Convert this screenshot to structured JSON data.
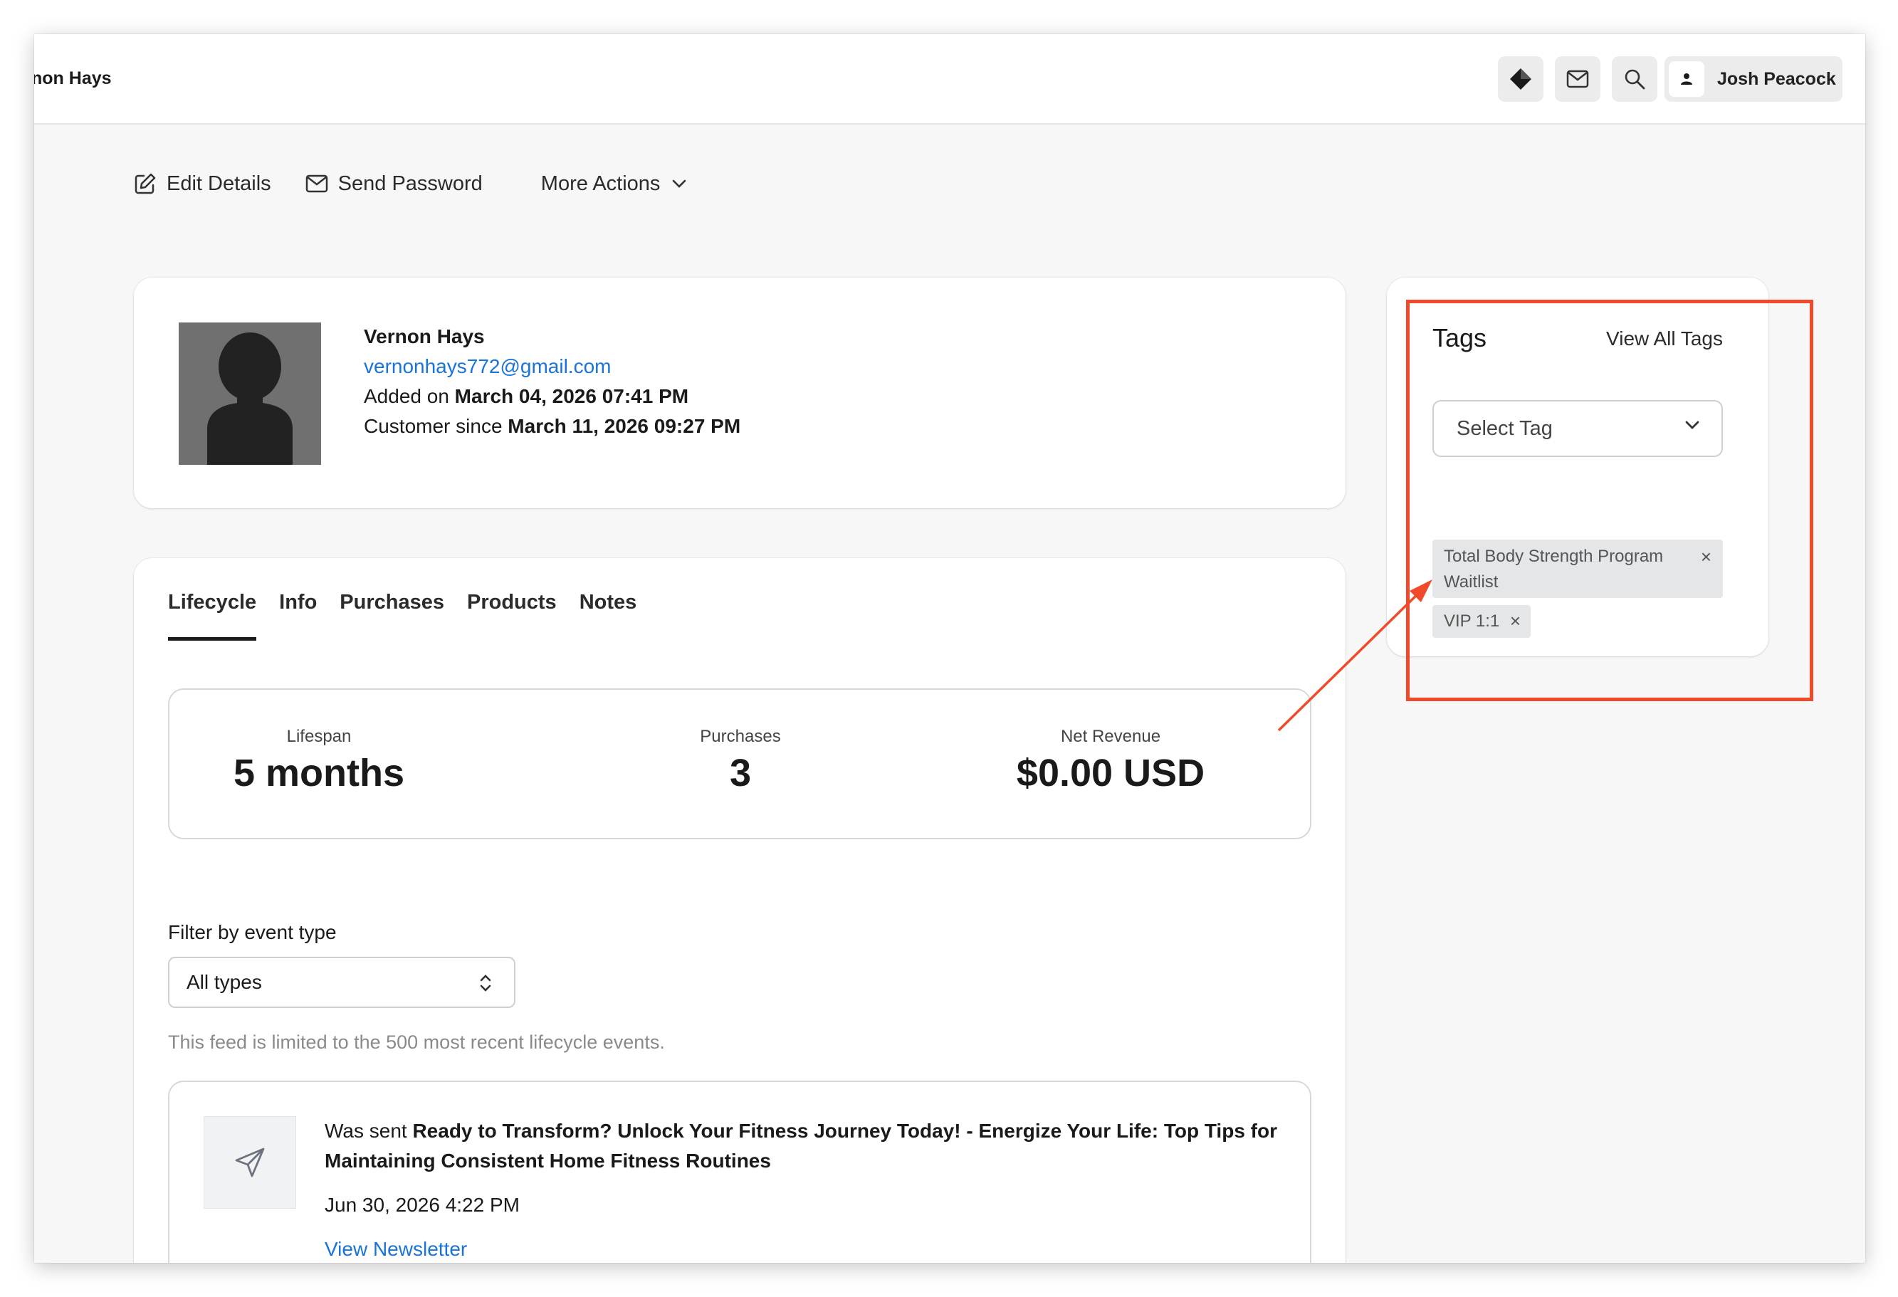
{
  "header": {
    "title_fragment": "non Hays",
    "icons": [
      "diamond-icon",
      "mail-icon",
      "search-icon",
      "user-icon"
    ],
    "user_name": "Josh Peacock"
  },
  "actions": {
    "edit": "Edit Details",
    "send_password": "Send Password",
    "more": "More Actions"
  },
  "profile": {
    "name": "Vernon Hays",
    "email": "vernonhays772@gmail.com",
    "added_prefix": "Added on",
    "added_date": "March 04, 2026 07:41 PM",
    "customer_prefix": "Customer since",
    "customer_date": "March 11, 2026 09:27 PM"
  },
  "tabs": [
    "Lifecycle",
    "Info",
    "Purchases",
    "Products",
    "Notes"
  ],
  "active_tab": "Lifecycle",
  "stats": [
    {
      "label": "Lifespan",
      "value": "5 months"
    },
    {
      "label": "Purchases",
      "value": "3"
    },
    {
      "label": "Net Revenue",
      "value": "$0.00 USD"
    }
  ],
  "filter": {
    "label": "Filter by event type",
    "selected": "All types",
    "note": "This feed is limited to the 500 most recent lifecycle events."
  },
  "event": {
    "prefix": "Was sent",
    "subject": "Ready to Transform? Unlock Your Fitness Journey Today! - Energize Your Life: Top Tips for Maintaining Consistent Home Fitness Routines",
    "date": "Jun 30, 2026 4:22 PM",
    "link": "View Newsletter",
    "icon": "paper-plane-icon"
  },
  "tags": {
    "title": "Tags",
    "view_all": "View All Tags",
    "select_placeholder": "Select Tag",
    "items": [
      "Total Body Strength Program Waitlist",
      "VIP 1:1"
    ]
  },
  "colors": {
    "accent_link": "#1a73d9",
    "annotation": "#f04a2a",
    "tag_bg": "#e4e6e8"
  }
}
